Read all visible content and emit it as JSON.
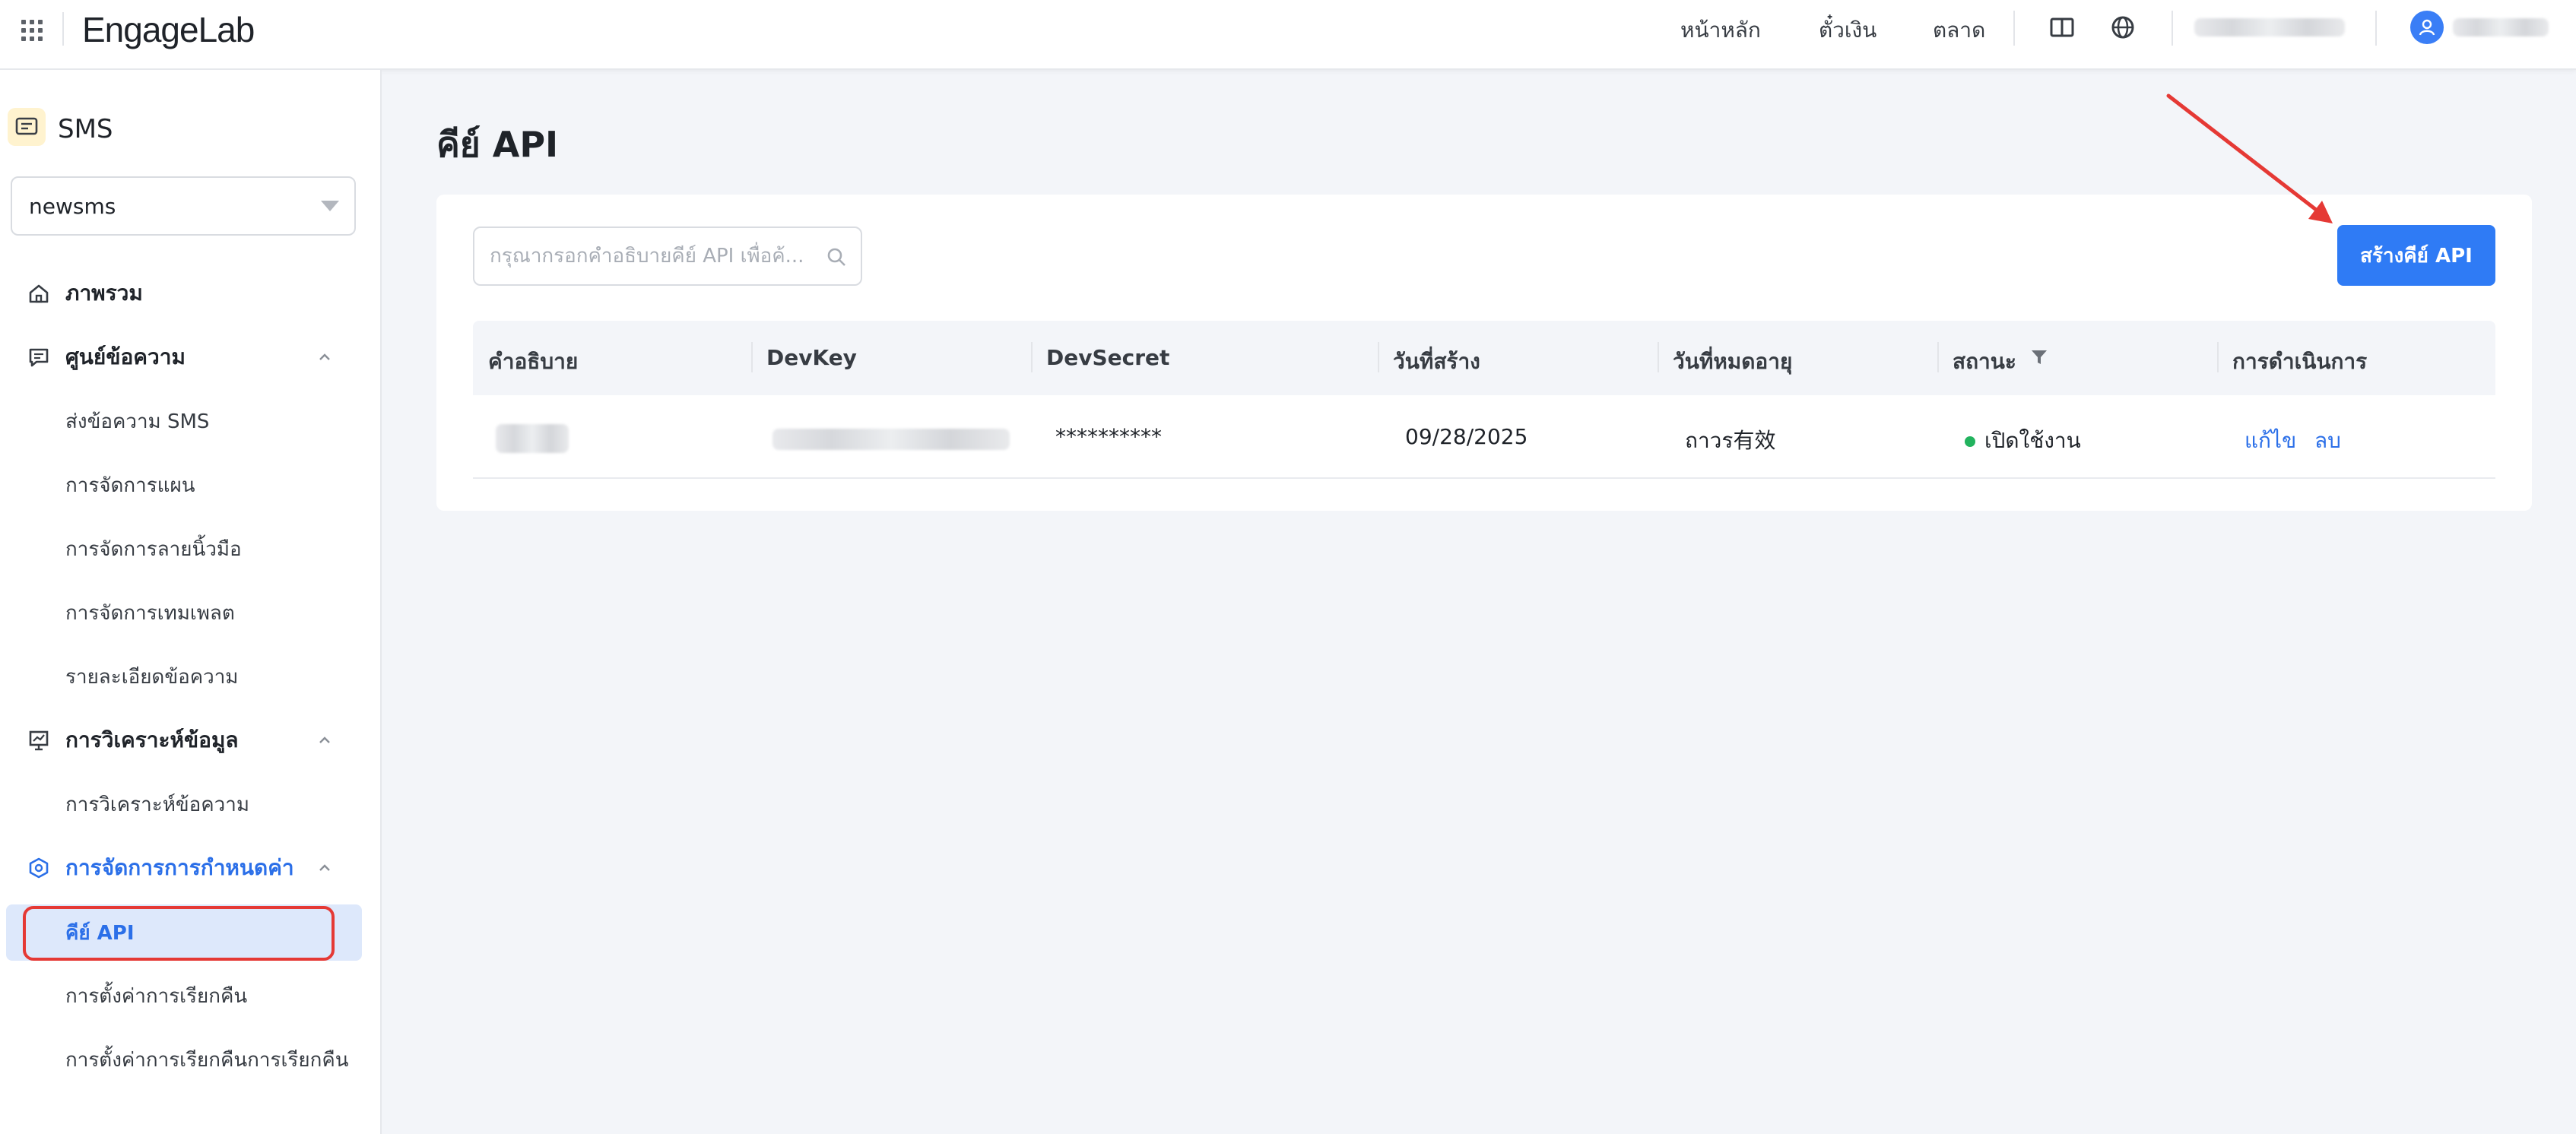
{
  "topbar": {
    "logo": "EngageLab",
    "nav": [
      {
        "label": "หน้าหลัก"
      },
      {
        "label": "ตั๋วเงิน"
      },
      {
        "label": "ตลาด"
      }
    ]
  },
  "sidebar": {
    "product": "SMS",
    "app_select": "newsms",
    "groups": [
      {
        "label": "ภาพรวม"
      },
      {
        "label": "ศูนย์ข้อความ",
        "items": [
          "ส่งข้อความ SMS",
          "การจัดการแผน",
          "การจัดการลายนิ้วมือ",
          "การจัดการเทมเพลต",
          "รายละเอียดข้อความ"
        ]
      },
      {
        "label": "การวิเคราะห์ข้อมูล",
        "items": [
          "การวิเคราะห์ข้อความ"
        ]
      },
      {
        "label": "การจัดการการกำหนดค่า",
        "items": [
          "คีย์ API",
          "การตั้งค่าการเรียกคืน",
          "การตั้งค่าการเรียกคืนการเรียกคืน"
        ]
      }
    ]
  },
  "main": {
    "title": "คีย์ API",
    "search_placeholder": "กรุณากรอกคำอธิบายคีย์ API เพื่อค้...",
    "create_button": "สร้างคีย์ API",
    "columns": [
      "คำอธิบาย",
      "DevKey",
      "DevSecret",
      "วันที่สร้าง",
      "วันที่หมดอายุ",
      "สถานะ",
      "การดำเนินการ"
    ],
    "rows": [
      {
        "dev_secret": "**********",
        "created": "09/28/2025",
        "expires": "ถาวร有效",
        "status": "เปิดใช้งาน",
        "actions": [
          "แก้ไข",
          "ลบ"
        ]
      }
    ]
  },
  "colors": {
    "accent": "#2f7bf5",
    "status_active": "#22b35e",
    "highlight_outline": "#e53935"
  }
}
